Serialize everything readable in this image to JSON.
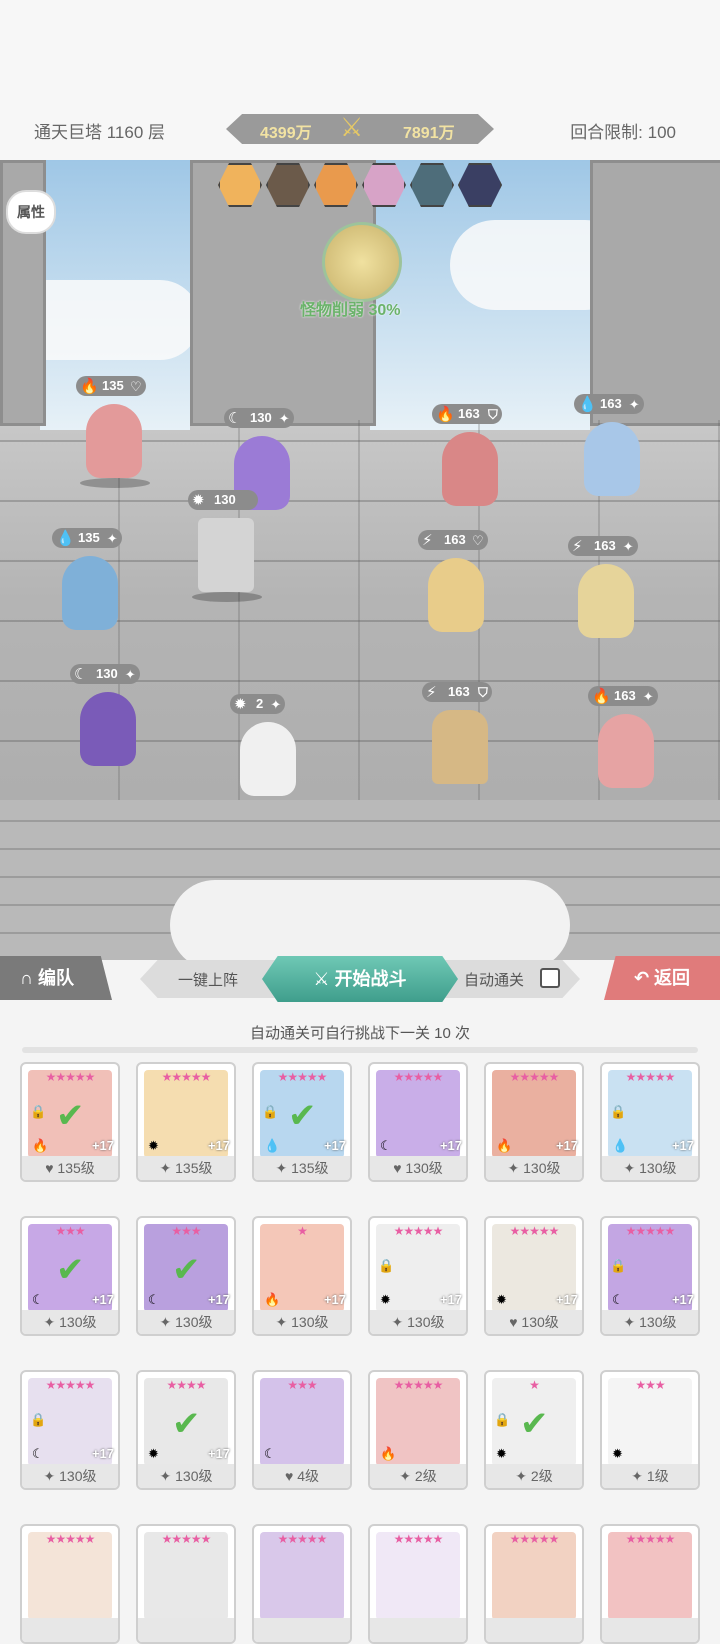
{
  "header": {
    "tower": "通天巨塔 1160 层",
    "power_left": "4399万",
    "power_right": "7891万",
    "round_limit": "回合限制: 100"
  },
  "battle": {
    "attr_button": "属性",
    "boss_buff": "怪物削弱 30%",
    "allies": [
      {
        "level": "135",
        "elem": "🔥",
        "role": "♡",
        "color": "#e39a9a"
      },
      {
        "level": "130",
        "elem": "☾",
        "role": "✦",
        "color": "#9b7bd6"
      },
      {
        "level": "130",
        "elem": "✹",
        "role": "",
        "color": "#d4d4d4"
      },
      {
        "level": "135",
        "elem": "💧",
        "role": "✦",
        "color": "#7fb0d8"
      },
      {
        "level": "130",
        "elem": "☾",
        "role": "✦",
        "color": "#7a5bb8"
      },
      {
        "level": "2",
        "elem": "✹",
        "role": "✦",
        "color": "#f0f0f0"
      }
    ],
    "enemies": [
      {
        "level": "163",
        "elem": "🔥",
        "role": "⛉",
        "color": "#d98787"
      },
      {
        "level": "163",
        "elem": "💧",
        "role": "✦",
        "color": "#a8c7e8"
      },
      {
        "level": "163",
        "elem": "⚡",
        "role": "♡",
        "color": "#e8cc8a"
      },
      {
        "level": "163",
        "elem": "⚡",
        "role": "✦",
        "color": "#e6d49a"
      },
      {
        "level": "163",
        "elem": "⚡",
        "role": "⛉",
        "color": "#d6b885"
      },
      {
        "level": "163",
        "elem": "🔥",
        "role": "✦",
        "color": "#e6a3a3"
      }
    ]
  },
  "controls": {
    "team": "编队",
    "one_key": "一键上阵",
    "start": "开始战斗",
    "auto": "自动通关",
    "back": "返回",
    "auto_info": "自动通关可自行挑战下一关 10 次"
  },
  "heroes": [
    {
      "level": "135级",
      "role": "♥",
      "elem": "🔥",
      "stars": "★★★★★",
      "plus": "+17",
      "lock": true,
      "check": true,
      "color": "#f1c0b8"
    },
    {
      "level": "135级",
      "role": "✦",
      "elem": "✹",
      "stars": "★★★★★",
      "plus": "+17",
      "lock": false,
      "check": false,
      "color": "#f5ddb0"
    },
    {
      "level": "135级",
      "role": "✦",
      "elem": "💧",
      "stars": "★★★★★",
      "plus": "+17",
      "lock": true,
      "check": true,
      "color": "#b8d7ef"
    },
    {
      "level": "130级",
      "role": "♥",
      "elem": "☾",
      "stars": "★★★★★",
      "plus": "+17",
      "lock": false,
      "check": false,
      "color": "#c9aee8"
    },
    {
      "level": "130级",
      "role": "✦",
      "elem": "🔥",
      "stars": "★★★★★",
      "plus": "+17",
      "lock": false,
      "check": false,
      "color": "#eab0a0"
    },
    {
      "level": "130级",
      "role": "✦",
      "elem": "💧",
      "stars": "★★★★★",
      "plus": "+17",
      "lock": true,
      "check": false,
      "color": "#c9e1f2"
    },
    {
      "level": "130级",
      "role": "✦",
      "elem": "☾",
      "stars": "★★★",
      "plus": "+17",
      "lock": false,
      "check": true,
      "color": "#c7a8e6"
    },
    {
      "level": "130级",
      "role": "✦",
      "elem": "☾",
      "stars": "★★★",
      "plus": "+17",
      "lock": false,
      "check": true,
      "color": "#b9a0de"
    },
    {
      "level": "130级",
      "role": "✦",
      "elem": "🔥",
      "stars": "★",
      "plus": "+17",
      "lock": false,
      "check": false,
      "color": "#f4c7b8"
    },
    {
      "level": "130级",
      "role": "✦",
      "elem": "✹",
      "stars": "★★★★★",
      "plus": "+17",
      "lock": true,
      "check": false,
      "color": "#eeeeee"
    },
    {
      "level": "130级",
      "role": "♥",
      "elem": "✹",
      "stars": "★★★★★",
      "plus": "+17",
      "lock": false,
      "check": false,
      "color": "#ece8e0"
    },
    {
      "level": "130级",
      "role": "✦",
      "elem": "☾",
      "stars": "★★★★★",
      "plus": "+17",
      "lock": true,
      "check": false,
      "color": "#c3a6e3"
    },
    {
      "level": "130级",
      "role": "✦",
      "elem": "☾",
      "stars": "★★★★★",
      "plus": "+17",
      "lock": true,
      "check": false,
      "color": "#e7e0ef"
    },
    {
      "level": "130级",
      "role": "✦",
      "elem": "✹",
      "stars": "★★★★",
      "plus": "+17",
      "lock": false,
      "check": true,
      "color": "#e8e8e8"
    },
    {
      "level": "4级",
      "role": "♥",
      "elem": "☾",
      "stars": "★★★",
      "plus": "",
      "lock": false,
      "check": false,
      "color": "#d4c2ea"
    },
    {
      "level": "2级",
      "role": "✦",
      "elem": "🔥",
      "stars": "★★★★★",
      "plus": "",
      "lock": false,
      "check": false,
      "color": "#f0c4c4"
    },
    {
      "level": "2级",
      "role": "✦",
      "elem": "✹",
      "stars": "★",
      "plus": "",
      "lock": true,
      "check": true,
      "color": "#efefef"
    },
    {
      "level": "1级",
      "role": "✦",
      "elem": "✹",
      "stars": "★★★",
      "plus": "",
      "lock": false,
      "check": false,
      "color": "#f4f4f4"
    },
    {
      "level": "",
      "role": "",
      "elem": "",
      "stars": "★★★★★",
      "plus": "",
      "lock": false,
      "check": false,
      "color": "#f4e4d8"
    },
    {
      "level": "",
      "role": "",
      "elem": "",
      "stars": "★★★★★",
      "plus": "",
      "lock": false,
      "check": false,
      "color": "#e8e8e8"
    },
    {
      "level": "",
      "role": "",
      "elem": "",
      "stars": "★★★★★",
      "plus": "",
      "lock": false,
      "check": false,
      "color": "#d9c8ea"
    },
    {
      "level": "",
      "role": "",
      "elem": "",
      "stars": "★★★★★",
      "plus": "",
      "lock": false,
      "check": false,
      "color": "#f0e8f6"
    },
    {
      "level": "",
      "role": "",
      "elem": "",
      "stars": "★★★★★",
      "plus": "",
      "lock": false,
      "check": false,
      "color": "#f2d2c2"
    },
    {
      "level": "",
      "role": "",
      "elem": "",
      "stars": "★★★★★",
      "plus": "",
      "lock": false,
      "check": false,
      "color": "#f2c2c2"
    }
  ]
}
